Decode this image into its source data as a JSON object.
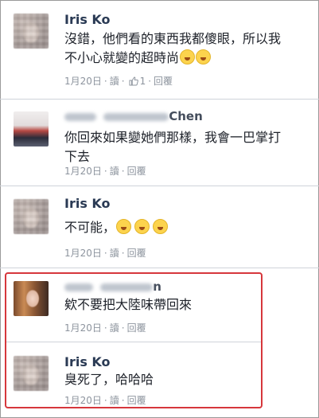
{
  "comments": [
    {
      "author": "Iris Ko",
      "text_lines": [
        "沒錯，他們看的東西我都傻眼，所以我",
        "不小心就變的超時尚"
      ],
      "emoji_count": 2,
      "date": "1月20日",
      "read": "讀",
      "like_count": "1",
      "reply": "回覆"
    },
    {
      "author": "Chen",
      "text_lines": [
        "你回來如果變她們那樣，我會一巴掌打",
        "下去"
      ],
      "date": "1月20日",
      "read": "讀",
      "reply": "回覆"
    },
    {
      "author": "Iris Ko",
      "text_lines": [
        "不可能，"
      ],
      "emoji_count": 3,
      "date": "1月20日",
      "read": "讀",
      "reply": "回覆"
    },
    {
      "author": "n",
      "text_lines": [
        "欸不要把大陸味帶回來"
      ],
      "date": "1月20日",
      "read": "讀",
      "reply": "回覆"
    },
    {
      "author": "Iris Ko",
      "text_lines": [
        "臭死了，哈哈哈"
      ],
      "date": "1月20日",
      "read": "讀",
      "reply": "回覆"
    }
  ],
  "separator": "·",
  "colors": {
    "name": "#2a3a54",
    "meta": "#8d949e",
    "highlight": "#d6373c"
  }
}
